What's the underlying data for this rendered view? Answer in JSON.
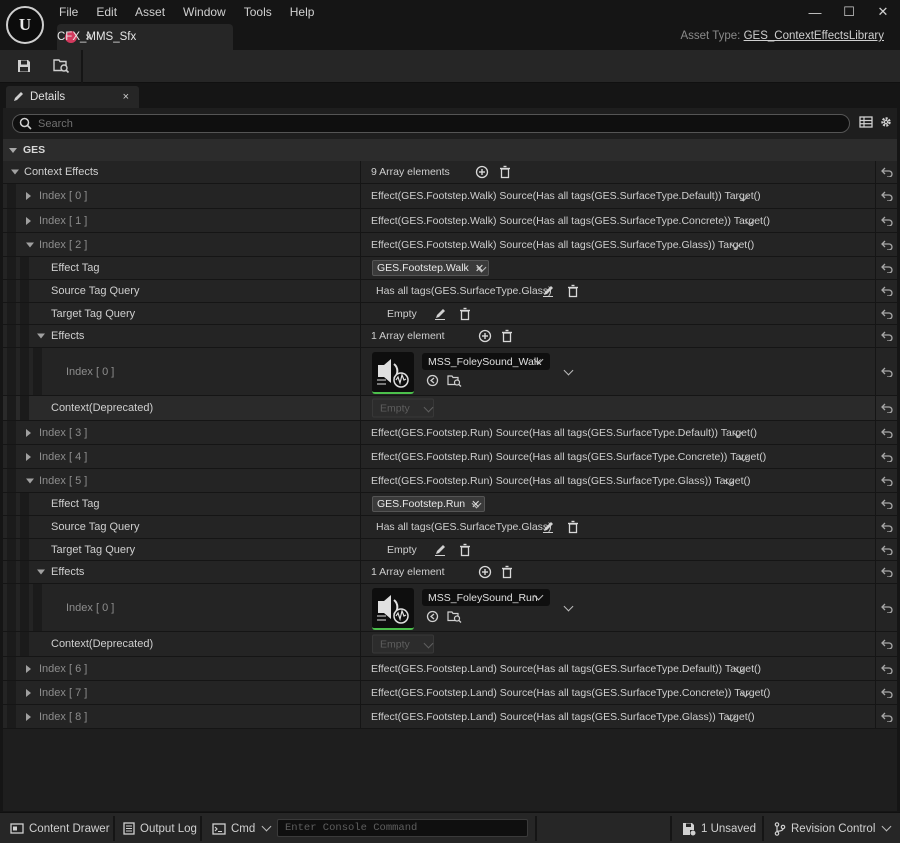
{
  "app": {
    "logo_text": "U"
  },
  "menu": [
    "File",
    "Edit",
    "Asset",
    "Window",
    "Tools",
    "Help"
  ],
  "window_controls": [
    "—",
    "☐",
    "✕"
  ],
  "asset_tab": {
    "label": "CFX_MMS_Sfx",
    "close": "×"
  },
  "asset_type": {
    "label": "Asset Type:",
    "value": "GES_ContextEffectsLibrary"
  },
  "toolbar": {
    "save_icon": "save-icon",
    "browse_icon": "browse-icon"
  },
  "details_tab": {
    "label": "Details",
    "close": "×"
  },
  "search": {
    "placeholder": "Search"
  },
  "category": {
    "name": "GES"
  },
  "context_effects": {
    "label": "Context Effects",
    "count": "9 Array elements"
  },
  "rows": [
    {
      "type": "index",
      "label": "Index [ 0 ]",
      "value": "Effect(GES.Footstep.Walk) Source(Has all tags(GES.SurfaceType.Default)) Target()"
    },
    {
      "type": "index",
      "label": "Index [ 1 ]",
      "value": "Effect(GES.Footstep.Walk) Source(Has all tags(GES.SurfaceType.Concrete)) Target()"
    },
    {
      "type": "index-open",
      "label": "Index [ 2 ]",
      "value": "Effect(GES.Footstep.Walk) Source(Has all tags(GES.SurfaceType.Glass)) Target()",
      "effect_tag_label": "Effect Tag",
      "effect_tag": "GES.Footstep.Walk",
      "source_label": "Source Tag Query",
      "source_value": "Has all tags(GES.SurfaceType.Glass)",
      "target_label": "Target Tag Query",
      "target_value": "Empty",
      "effects_label": "Effects",
      "effects_count": "1 Array element",
      "effect_index_label": "Index [ 0 ]",
      "effect_asset": "MSS_FoleySound_Walk",
      "context_label": "Context(Deprecated)",
      "context_value": "Empty"
    },
    {
      "type": "index",
      "label": "Index [ 3 ]",
      "value": "Effect(GES.Footstep.Run) Source(Has all tags(GES.SurfaceType.Default)) Target()"
    },
    {
      "type": "index",
      "label": "Index [ 4 ]",
      "value": "Effect(GES.Footstep.Run) Source(Has all tags(GES.SurfaceType.Concrete)) Target()"
    },
    {
      "type": "index-open",
      "label": "Index [ 5 ]",
      "value": "Effect(GES.Footstep.Run) Source(Has all tags(GES.SurfaceType.Glass)) Target()",
      "effect_tag_label": "Effect Tag",
      "effect_tag": "GES.Footstep.Run",
      "source_label": "Source Tag Query",
      "source_value": "Has all tags(GES.SurfaceType.Glass)",
      "target_label": "Target Tag Query",
      "target_value": "Empty",
      "effects_label": "Effects",
      "effects_count": "1 Array element",
      "effect_index_label": "Index [ 0 ]",
      "effect_asset": "MSS_FoleySound_Run",
      "context_label": "Context(Deprecated)",
      "context_value": "Empty"
    },
    {
      "type": "index",
      "label": "Index [ 6 ]",
      "value": "Effect(GES.Footstep.Land) Source(Has all tags(GES.SurfaceType.Default)) Target()"
    },
    {
      "type": "index",
      "label": "Index [ 7 ]",
      "value": "Effect(GES.Footstep.Land) Source(Has all tags(GES.SurfaceType.Concrete)) Target()"
    },
    {
      "type": "index",
      "label": "Index [ 8 ]",
      "value": "Effect(GES.Footstep.Land) Source(Has all tags(GES.SurfaceType.Glass)) Target()"
    }
  ],
  "statusbar": {
    "content_drawer": "Content Drawer",
    "output_log": "Output Log",
    "cmd": "Cmd",
    "console_placeholder": "Enter Console Command",
    "unsaved": "1 Unsaved",
    "revision_control": "Revision Control"
  },
  "colors": {
    "accent_tab_dot": "#d33a5e",
    "asset_green": "#4cc04c",
    "background": "#151515",
    "panel": "#242424"
  }
}
